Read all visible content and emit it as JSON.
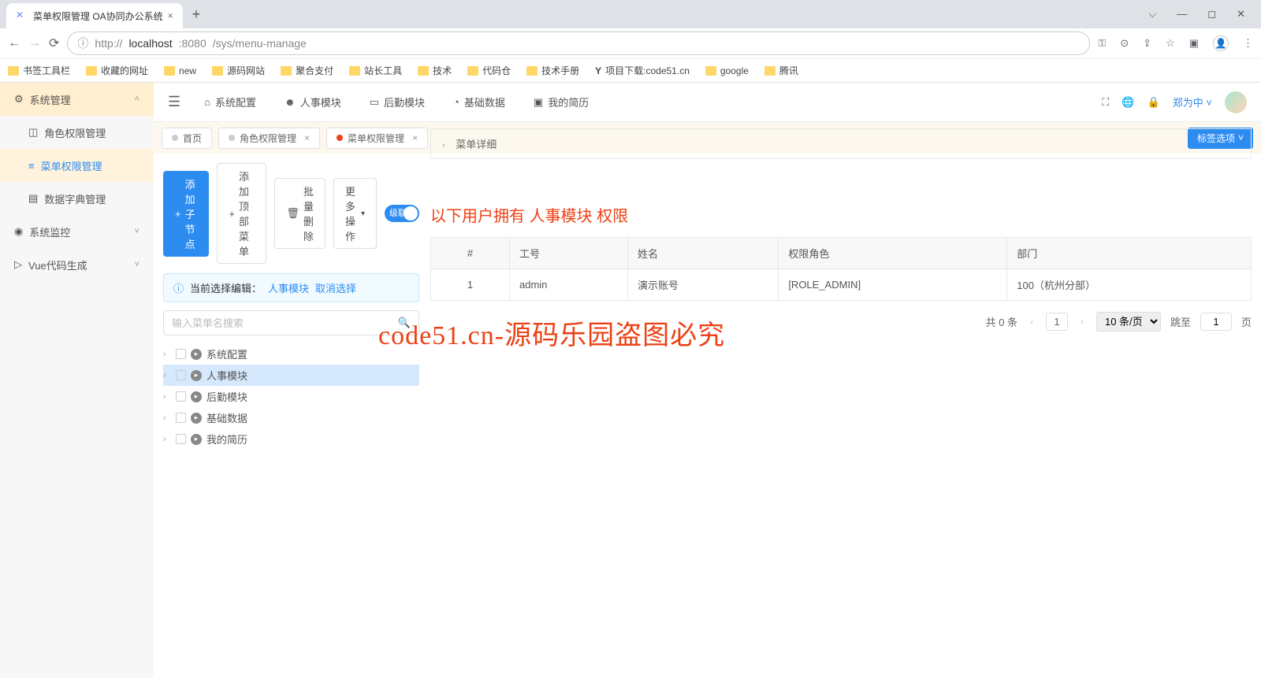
{
  "browser": {
    "tab_title": "菜单权限管理 OA协同办公系统",
    "url_prefix": "http://",
    "url_host": "localhost",
    "url_port": ":8080",
    "url_path": "/sys/menu-manage",
    "bookmarks": [
      "书签工具栏",
      "收藏的网址",
      "new",
      "源码网站",
      "聚合支付",
      "站长工具",
      "技术",
      "代码仓",
      "技术手册",
      "项目下载:code51.cn",
      "google",
      "腾讯"
    ]
  },
  "sidebar": {
    "groups": [
      {
        "label": "系统管理",
        "expanded": true,
        "items": [
          "角色权限管理",
          "菜单权限管理",
          "数据字典管理"
        ],
        "active_index": 1
      },
      {
        "label": "系统监控",
        "expanded": false
      },
      {
        "label": "Vue代码生成",
        "expanded": false
      }
    ]
  },
  "topnav": [
    "系统配置",
    "人事模块",
    "后勤模块",
    "基础数据",
    "我的简历"
  ],
  "username": "郑为中",
  "page_tabs": [
    {
      "label": "首页",
      "closable": false,
      "active": false
    },
    {
      "label": "角色权限管理",
      "closable": true,
      "active": false
    },
    {
      "label": "菜单权限管理",
      "closable": true,
      "active": true
    }
  ],
  "tab_options_label": "标签选项",
  "actions": {
    "add_child": "添加子节点",
    "add_top": "添加顶部菜单",
    "bulk_delete": "批量删除",
    "more": "更多操作",
    "toggle_label": "级联"
  },
  "info_bar": {
    "prefix": "当前选择编辑：",
    "selected": "人事模块",
    "cancel": "取消选择"
  },
  "search_placeholder": "输入菜单名搜索",
  "tree": [
    "系统配置",
    "人事模块",
    "后勤模块",
    "基础数据",
    "我的简历"
  ],
  "tree_selected_index": 1,
  "detail_header": "菜单详细",
  "permission_note": {
    "prefix": "以下用户拥有 ",
    "entity": "人事模块",
    "suffix": " 权限"
  },
  "table": {
    "headers": [
      "#",
      "工号",
      "姓名",
      "权限角色",
      "部门"
    ],
    "rows": [
      [
        "1",
        "admin",
        "演示账号",
        "[ROLE_ADMIN]",
        "100（杭州分部）"
      ]
    ]
  },
  "pager": {
    "total": "共 0 条",
    "page": "1",
    "size": "10 条/页",
    "jump_label": "跳至",
    "jump_value": "1",
    "page_suffix": "页"
  },
  "watermark": "code51.cn-源码乐园盗图必究"
}
